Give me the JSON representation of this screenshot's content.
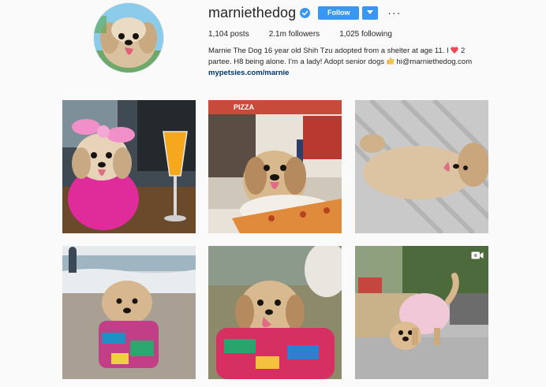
{
  "profile": {
    "username": "marniethedog",
    "verified": true,
    "follow_label": "Follow",
    "more_label": "···",
    "stats": {
      "posts": "1,104 posts",
      "followers": "2.1m followers",
      "following": "1,025 following"
    },
    "bio": {
      "line1_a": "Marnie The Dog 16 year old Shih Tzu adopted from a shelter at age 11. I",
      "line1_b": "2",
      "line2_a": "partee. H8 being alone. I'm a lady! Adopt senior dogs",
      "line2_b": "hi@marniethedog.com",
      "link": "mypetsies.com/marnie"
    }
  },
  "posts": [
    {
      "id": 1,
      "scene": "dog with pink bow and sweater beside mimosa glass",
      "type": "photo"
    },
    {
      "id": 2,
      "scene": "dog at pizza shop with slice of pizza",
      "type": "photo",
      "sign": "PIZZA"
    },
    {
      "id": 3,
      "scene": "dog lying on back on striped blanket",
      "type": "photo"
    },
    {
      "id": 4,
      "scene": "dog in colorful shirt at beach",
      "type": "photo"
    },
    {
      "id": 5,
      "scene": "dog in colorful shirt with tongue out",
      "type": "photo"
    },
    {
      "id": 6,
      "scene": "dog in pink raincoat on sidewalk",
      "type": "video"
    }
  ],
  "colors": {
    "accent": "#3897f0",
    "background": "#fafafa",
    "text": "#262626",
    "link": "#003569",
    "heart": "#ed4956"
  },
  "icons": {
    "verified": "verified-badge-icon",
    "dropdown": "chevron-down-icon",
    "heart": "heart-icon",
    "thumbs_up": "thumbs-up-icon",
    "video": "video-camera-icon"
  }
}
